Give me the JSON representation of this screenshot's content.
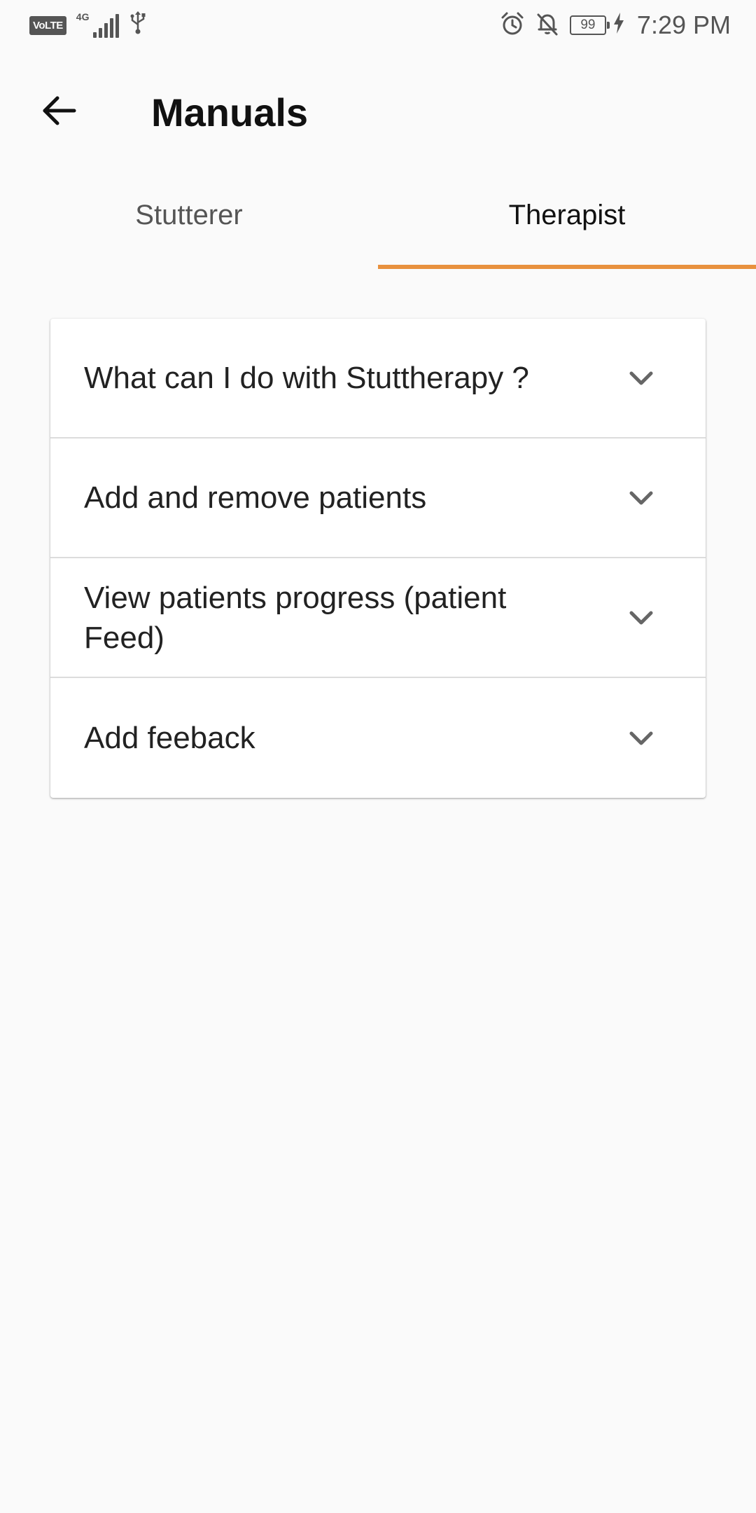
{
  "status_bar": {
    "volte": "VoLTE",
    "network": "4G",
    "battery": "99",
    "time": "7:29 PM",
    "icons": [
      "volte-icon",
      "signal-icon",
      "usb-icon",
      "alarm-icon",
      "bell-off-icon",
      "battery-icon",
      "charging-icon"
    ]
  },
  "app_bar": {
    "title": "Manuals",
    "back_icon": "arrow-left-icon"
  },
  "tabs": [
    {
      "label": "Stutterer",
      "active": false
    },
    {
      "label": "Therapist",
      "active": true
    }
  ],
  "accent_color": "#e8913e",
  "accordion": {
    "items": [
      {
        "title": "What can I do with Stuttherapy ?",
        "icon": "chevron-down-icon"
      },
      {
        "title": "Add and remove patients",
        "icon": "chevron-down-icon"
      },
      {
        "title": "View patients progress (patient Feed)",
        "icon": "chevron-down-icon"
      },
      {
        "title": "Add feeback",
        "icon": "chevron-down-icon"
      }
    ]
  }
}
